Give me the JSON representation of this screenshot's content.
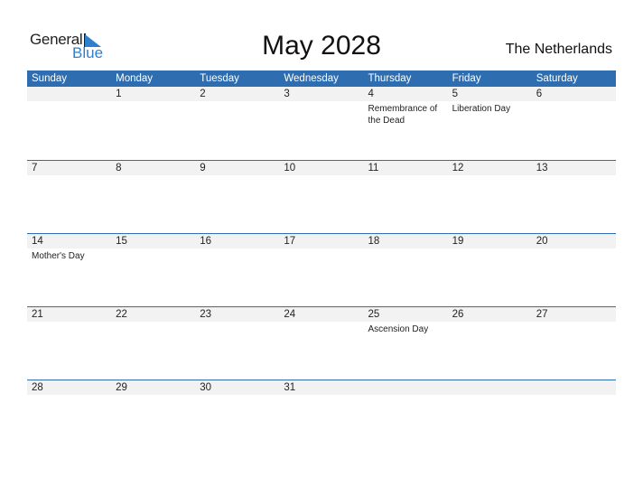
{
  "logo": {
    "general": "General",
    "blue": "Blue"
  },
  "title": "May 2028",
  "country": "The Netherlands",
  "colors": {
    "accent": "#2e6eb0",
    "logo_blue": "#2e7fd0",
    "date_strip": "#f2f2f2"
  },
  "weekdays": [
    "Sunday",
    "Monday",
    "Tuesday",
    "Wednesday",
    "Thursday",
    "Friday",
    "Saturday"
  ],
  "weeks": [
    [
      {
        "day": ""
      },
      {
        "day": "1"
      },
      {
        "day": "2"
      },
      {
        "day": "3"
      },
      {
        "day": "4",
        "event": "Remembrance of the Dead"
      },
      {
        "day": "5",
        "event": "Liberation Day"
      },
      {
        "day": "6"
      }
    ],
    [
      {
        "day": "7"
      },
      {
        "day": "8"
      },
      {
        "day": "9"
      },
      {
        "day": "10"
      },
      {
        "day": "11"
      },
      {
        "day": "12"
      },
      {
        "day": "13"
      }
    ],
    [
      {
        "day": "14",
        "event": "Mother's Day"
      },
      {
        "day": "15"
      },
      {
        "day": "16"
      },
      {
        "day": "17"
      },
      {
        "day": "18"
      },
      {
        "day": "19"
      },
      {
        "day": "20"
      }
    ],
    [
      {
        "day": "21"
      },
      {
        "day": "22"
      },
      {
        "day": "23"
      },
      {
        "day": "24"
      },
      {
        "day": "25",
        "event": "Ascension Day"
      },
      {
        "day": "26"
      },
      {
        "day": "27"
      }
    ],
    [
      {
        "day": "28"
      },
      {
        "day": "29"
      },
      {
        "day": "30"
      },
      {
        "day": "31"
      },
      {
        "day": ""
      },
      {
        "day": ""
      },
      {
        "day": ""
      }
    ]
  ]
}
